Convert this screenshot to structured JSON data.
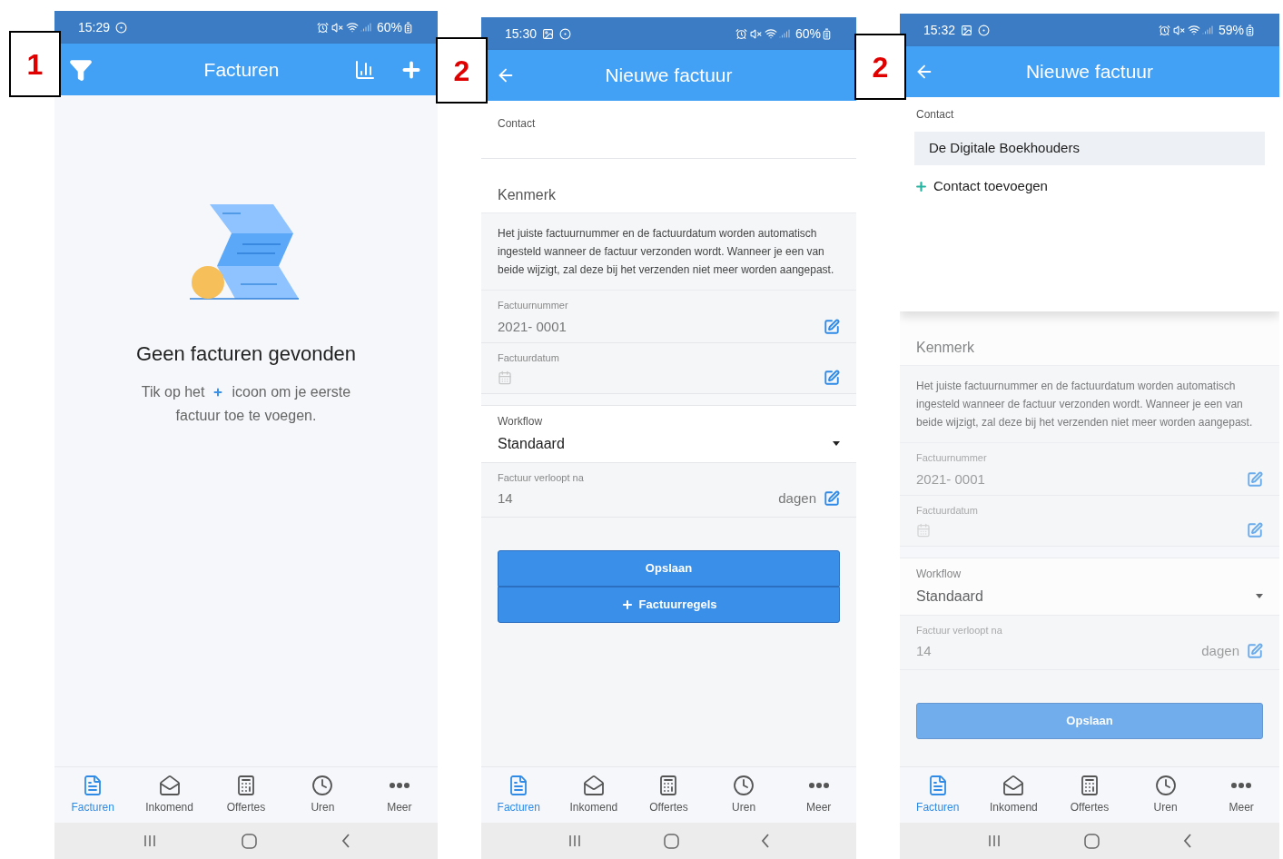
{
  "screens": [
    {
      "kind": "list",
      "step_label": "1",
      "status_bar": {
        "time": "15:29",
        "notifications": [
          {
            "kind": "record"
          }
        ],
        "battery": "60%"
      },
      "header": {
        "title": "Facturen"
      },
      "empty_state": {
        "title": "Geen facturen gevonden",
        "text_before": "Tik op het",
        "text_after": "icoon om je eerste",
        "text_line2": "factuur toe te voegen."
      },
      "tabs": [
        {
          "label": "Facturen",
          "selected": true
        },
        {
          "label": "Inkomend",
          "selected": false
        },
        {
          "label": "Offertes",
          "selected": false
        },
        {
          "label": "Uren",
          "selected": false
        },
        {
          "label": "Meer",
          "selected": false
        }
      ]
    },
    {
      "kind": "form",
      "step_label": "2",
      "status_bar": {
        "time": "15:30",
        "notifications": [
          {
            "kind": "image"
          },
          {
            "kind": "record"
          }
        ],
        "battery": "60%"
      },
      "header": {
        "title": "Nieuwe factuur"
      },
      "form": {
        "dimmed": false,
        "contact_label": "Contact",
        "kenmerk": "Kenmerk",
        "info": "Het juiste factuurnummer en de factuurdatum worden automatisch ingesteld wanneer de factuur verzonden wordt. Wanneer je een van beide wijzigt, zal deze bij het verzenden niet meer worden aangepast.",
        "invoice_number": {
          "label": "Factuurnummer",
          "value": "2021- 0001"
        },
        "invoice_date": {
          "label": "Factuurdatum"
        },
        "workflow": {
          "label": "Workflow",
          "value": "Standaard"
        },
        "expiry": {
          "label": "Factuur verloopt na",
          "value": "14",
          "unit": "dagen"
        },
        "buttons": [
          {
            "kind": "save",
            "label": "Opslaan"
          },
          {
            "kind": "add",
            "label": "Factuurregels"
          }
        ]
      },
      "tabs": [
        {
          "label": "Facturen",
          "selected": true
        },
        {
          "label": "Inkomend",
          "selected": false
        },
        {
          "label": "Offertes",
          "selected": false
        },
        {
          "label": "Uren",
          "selected": false
        },
        {
          "label": "Meer",
          "selected": false
        }
      ]
    },
    {
      "kind": "form",
      "step_label": "2",
      "status_bar": {
        "time": "15:32",
        "notifications": [
          {
            "kind": "image"
          },
          {
            "kind": "record"
          }
        ],
        "battery": "59%"
      },
      "header": {
        "title": "Nieuwe factuur"
      },
      "contact_sheet": {
        "label": "Contact",
        "options": [
          {
            "label": "De Digitale Boekhouders",
            "selected": true
          }
        ],
        "add_label": "Contact toevoegen"
      },
      "form": {
        "dimmed": true,
        "kenmerk": "Kenmerk",
        "info": "Het juiste factuurnummer en de factuurdatum worden automatisch ingesteld wanneer de factuur verzonden wordt. Wanneer je een van beide wijzigt, zal deze bij het verzenden niet meer worden aangepast.",
        "invoice_number": {
          "label": "Factuurnummer",
          "value": "2021- 0001"
        },
        "invoice_date": {
          "label": "Factuurdatum"
        },
        "workflow": {
          "label": "Workflow",
          "value": "Standaard"
        },
        "expiry": {
          "label": "Factuur verloopt na",
          "value": "14",
          "unit": "dagen"
        },
        "buttons": [
          {
            "kind": "save",
            "label": "Opslaan"
          }
        ]
      },
      "tabs": [
        {
          "label": "Facturen",
          "selected": true
        },
        {
          "label": "Inkomend",
          "selected": false
        },
        {
          "label": "Offertes",
          "selected": false
        },
        {
          "label": "Uren",
          "selected": false
        },
        {
          "label": "Meer",
          "selected": false
        }
      ]
    }
  ]
}
